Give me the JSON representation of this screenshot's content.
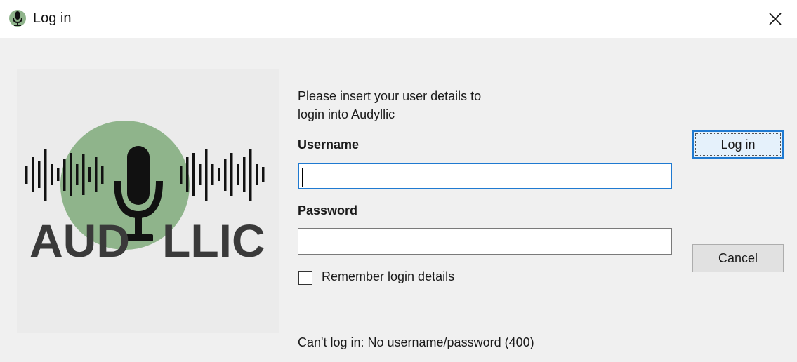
{
  "window": {
    "title": "Log in",
    "icon": "microphone-icon",
    "close_icon": "close-icon"
  },
  "logo": {
    "wordmark": "AUDILLIC",
    "circle_color": "#8fb48b",
    "text_color": "#3a3a3a"
  },
  "form": {
    "intro_line1": "Please insert your user details to",
    "intro_line2": "login into Audyllic",
    "username_label": "Username",
    "username_value": "",
    "password_label": "Password",
    "password_value": "",
    "remember_label": "Remember login details",
    "remember_checked": false
  },
  "buttons": {
    "login": "Log in",
    "cancel": "Cancel"
  },
  "status": {
    "message": "Can't log in: No username/password (400)"
  },
  "colors": {
    "accent": "#1f7ad1",
    "background": "#f0f0f0"
  }
}
